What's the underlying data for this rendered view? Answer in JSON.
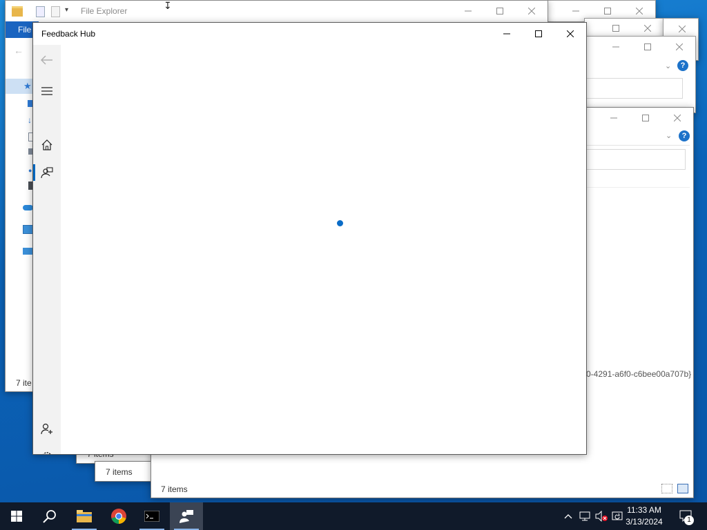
{
  "explorer_main": {
    "title": "File Explorer",
    "menu_file": "File",
    "status": "7 ite"
  },
  "stack_windows": {
    "status_a": "7 items",
    "status_b": "7 items",
    "status_c": "7 items",
    "guid_fragment": "0-4291-a6f0-c6bee00a707b}",
    "help_glyph": "?"
  },
  "feedback_hub": {
    "title": "Feedback Hub",
    "rail": {
      "back": "back-icon",
      "menu": "hamburger-icon",
      "home": "home-icon",
      "feedback": "feedback-icon",
      "account": "add-account-icon",
      "settings": "gear-icon"
    }
  },
  "taskbar": {
    "time": "11:33 AM",
    "date": "3/13/2024",
    "notification_count": "1"
  },
  "colors": {
    "accent": "#0067c0",
    "taskbar": "#101a2a",
    "desktop": "#0b63b8"
  }
}
